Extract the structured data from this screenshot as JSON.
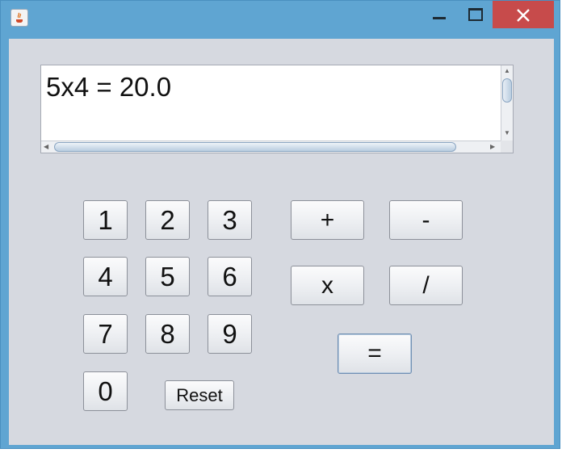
{
  "display": {
    "text": "5x4 = 20.0"
  },
  "keypad": {
    "one": "1",
    "two": "2",
    "three": "3",
    "four": "4",
    "five": "5",
    "six": "6",
    "seven": "7",
    "eight": "8",
    "nine": "9",
    "zero": "0",
    "reset": "Reset"
  },
  "operators": {
    "plus": "+",
    "minus": "-",
    "multiply": "x",
    "divide": "/",
    "equals": "="
  },
  "titlebar": {
    "close_color": "#c74b4b",
    "frame_color": "#5fa5d2"
  }
}
